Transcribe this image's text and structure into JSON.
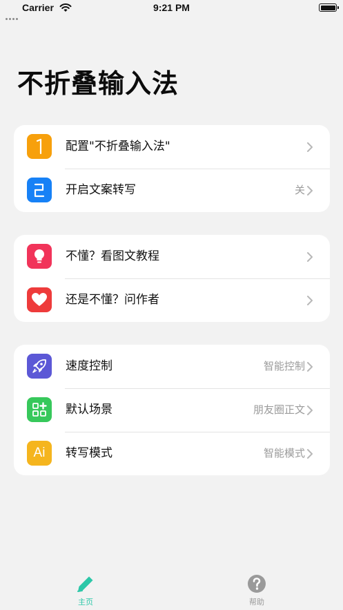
{
  "status_bar": {
    "carrier": "Carrier",
    "time": "9:21 PM"
  },
  "page": {
    "title": "不折叠输入法"
  },
  "sections": [
    {
      "items": [
        {
          "label": "配置\"不折叠输入法\"",
          "value": "",
          "icon": "number-1-icon",
          "icon_color": "#f7a00c"
        },
        {
          "label": "开启文案转写",
          "value": "关",
          "icon": "number-2-icon",
          "icon_color": "#1781f6"
        }
      ]
    },
    {
      "items": [
        {
          "label": "不懂？看图文教程",
          "value": "",
          "icon": "lightbulb-icon",
          "icon_color": "#f1345a"
        },
        {
          "label": "还是不懂？问作者",
          "value": "",
          "icon": "heart-icon",
          "icon_color": "#ee3b3b"
        }
      ]
    },
    {
      "items": [
        {
          "label": "速度控制",
          "value": "智能控制",
          "icon": "rocket-icon",
          "icon_color": "#5c58d6"
        },
        {
          "label": "默认场景",
          "value": "朋友圈正文",
          "icon": "grid-plus-icon",
          "icon_color": "#37c85b"
        },
        {
          "label": "转写模式",
          "value": "智能模式",
          "icon": "ai-icon",
          "icon_color": "#f5b51e",
          "icon_text": "Ai"
        }
      ]
    }
  ],
  "tab_bar": {
    "tabs": [
      {
        "label": "主页",
        "icon": "pencil-icon",
        "color": "#2cc7a8",
        "active": true
      },
      {
        "label": "帮助",
        "icon": "question-icon",
        "color": "#9a9a9a",
        "active": false
      }
    ]
  },
  "colors": {
    "background": "#f2f2f2",
    "card": "#ffffff",
    "secondary_text": "#9a9a9a",
    "accent": "#2cc7a8"
  }
}
